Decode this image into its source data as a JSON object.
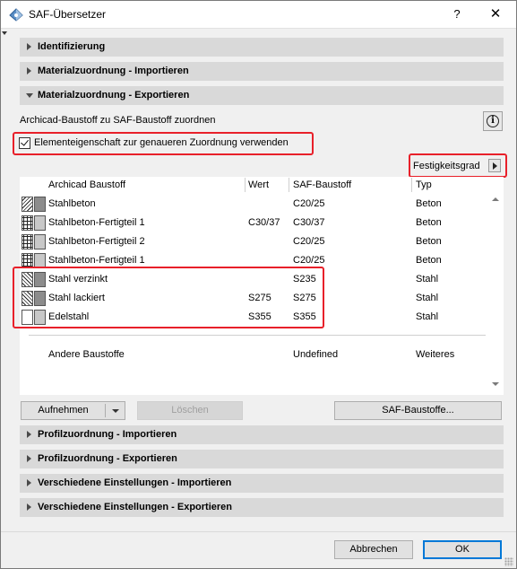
{
  "window": {
    "title": "SAF-Übersetzer",
    "help": "?",
    "close": "✕"
  },
  "sections": {
    "identifizierung": "Identifizierung",
    "mat_import": "Materialzuordnung - Importieren",
    "mat_export": "Materialzuordnung - Exportieren",
    "profil_import": "Profilzuordnung - Importieren",
    "profil_export": "Profilzuordnung - Exportieren",
    "versch_import": "Verschiedene Einstellungen - Importieren",
    "versch_export": "Verschiedene Einstellungen - Exportieren"
  },
  "assign": {
    "label": "Archicad-Baustoff zu SAF-Baustoff zuordnen",
    "info": "i",
    "checkbox_label": "Elementeigenschaft zur genaueren Zuordnung verwenden",
    "checkbox_checked": true,
    "property": "Festigkeitsgrad"
  },
  "table": {
    "headers": {
      "archicad": "Archicad Baustoff",
      "wert": "Wert",
      "saf": "SAF-Baustoff",
      "typ": "Typ"
    },
    "rows": [
      {
        "name": "Stahlbeton",
        "wert": "",
        "saf": "C20/25",
        "typ": "Beton",
        "pattern": "hatch",
        "color": "#8c8c8c"
      },
      {
        "name": "Stahlbeton-Fertigteil 1",
        "wert": "C30/37",
        "saf": "C30/37",
        "typ": "Beton",
        "pattern": "grid",
        "color": "#c8c8c8"
      },
      {
        "name": "Stahlbeton-Fertigteil 2",
        "wert": "",
        "saf": "C20/25",
        "typ": "Beton",
        "pattern": "grid",
        "color": "#c8c8c8"
      },
      {
        "name": "Stahlbeton-Fertigteil 1",
        "wert": "",
        "saf": "C20/25",
        "typ": "Beton",
        "pattern": "grid",
        "color": "#c8c8c8"
      },
      {
        "name": "Stahl verzinkt",
        "wert": "",
        "saf": "S235",
        "typ": "Stahl",
        "pattern": "diag",
        "color": "#8c8c8c"
      },
      {
        "name": "Stahl lackiert",
        "wert": "S275",
        "saf": "S275",
        "typ": "Stahl",
        "pattern": "diag",
        "color": "#8c8c8c"
      },
      {
        "name": "Edelstahl",
        "wert": "S355",
        "saf": "S355",
        "typ": "Stahl",
        "pattern": "blank",
        "color": "#c8c8c8"
      }
    ],
    "other": {
      "name": "Andere Baustoffe",
      "saf": "Undefined",
      "typ": "Weiteres"
    }
  },
  "buttons": {
    "aufnehmen": "Aufnehmen",
    "loeschen": "Löschen",
    "saf_baustoffe": "SAF-Baustoffe...",
    "abbrechen": "Abbrechen",
    "ok": "OK"
  },
  "colors": {
    "highlight": "#e8202a",
    "section_bg": "#d9d9d9",
    "default_button": "#0078d7"
  }
}
